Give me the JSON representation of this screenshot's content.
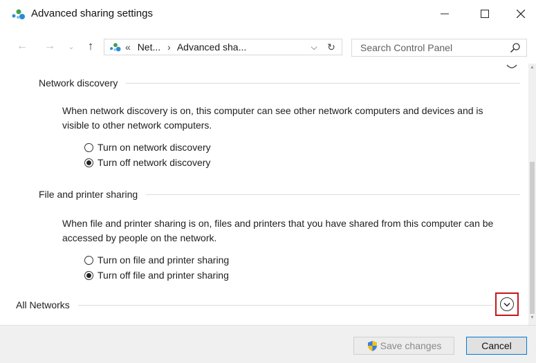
{
  "window": {
    "title": "Advanced sharing settings",
    "app_icon": "network-sharing-icon"
  },
  "address": {
    "crumbs": [
      "«",
      "Net...",
      "›",
      "Advanced sha..."
    ],
    "dropdown_glyph": "⌵",
    "refresh_glyph": "↻"
  },
  "search": {
    "placeholder": "Search Control Panel"
  },
  "sections": {
    "network_discovery": {
      "title": "Network discovery",
      "description": "When network discovery is on, this computer can see other network computers and devices and is visible to other network computers.",
      "options": [
        {
          "label": "Turn on network discovery",
          "checked": false
        },
        {
          "label": "Turn off network discovery",
          "checked": true
        }
      ]
    },
    "file_printer": {
      "title": "File and printer sharing",
      "description": "When file and printer sharing is on, files and printers that you have shared from this computer can be accessed by people on the network.",
      "options": [
        {
          "label": "Turn on file and printer sharing",
          "checked": false
        },
        {
          "label": "Turn off file and printer sharing",
          "checked": true
        }
      ]
    },
    "all_networks": {
      "title": "All Networks",
      "expand_icon": "chevron-down-circle-icon"
    }
  },
  "footer": {
    "save_label": "Save changes",
    "cancel_label": "Cancel"
  },
  "colors": {
    "highlight": "#c4161c",
    "accent": "#0078d7"
  }
}
